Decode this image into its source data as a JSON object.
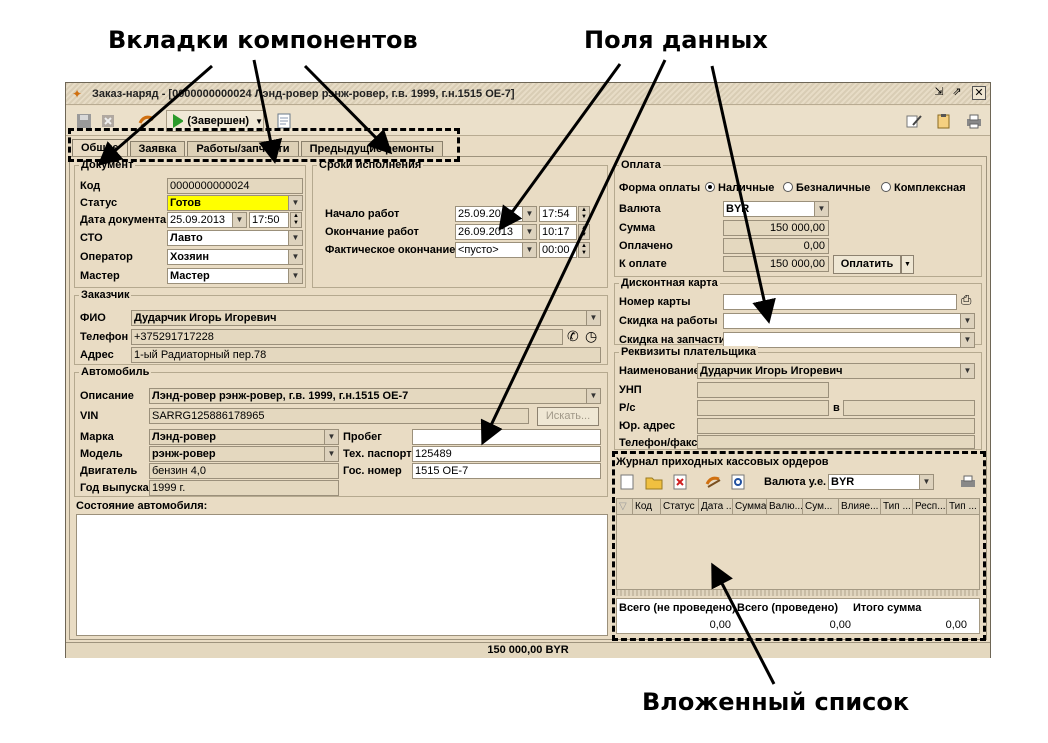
{
  "annotations": {
    "tabs_label": "Вкладки компонентов",
    "fields_label": "Поля данных",
    "nested_label": "Вложенный список"
  },
  "window": {
    "title": "Заказ-наряд - [0000000000024 Лэнд-ровер рэнж-ровер, г.в. 1999, г.н.1515 ОЕ-7]",
    "status_button": "(Завершен)"
  },
  "tabs": [
    "Общие",
    "Заявка",
    "Работы/запчасти",
    "Предыдущие ремонты"
  ],
  "document": {
    "title": "Документ",
    "code_label": "Код",
    "code": "0000000000024",
    "status_label": "Статус",
    "status": "Готов",
    "date_label": "Дата документа",
    "date": "25.09.2013",
    "time": "17:50",
    "sto_label": "СТО",
    "sto": "Лавто",
    "operator_label": "Оператор",
    "operator": "Хозяин",
    "master_label": "Мастер",
    "master": "Мастер"
  },
  "terms": {
    "title": "Сроки исполнения",
    "start_label": "Начало работ",
    "start_date": "25.09.2013",
    "start_time": "17:54",
    "end_label": "Окончание работ",
    "end_date": "26.09.2013",
    "end_time": "10:17",
    "actual_label": "Фактическое окончание",
    "actual_date": "<пусто>",
    "actual_time": "00:00"
  },
  "customer": {
    "title": "Заказчик",
    "fio_label": "ФИО",
    "fio": "Дударчик Игорь Игоревич",
    "phone_label": "Телефон",
    "phone": "+375291717228",
    "address_label": "Адрес",
    "address": "1-ый Радиаторный пер.78"
  },
  "car": {
    "title": "Автомобиль",
    "desc_label": "Описание",
    "desc": "Лэнд-ровер рэнж-ровер, г.в. 1999, г.н.1515 ОЕ-7",
    "vin_label": "VIN",
    "vin": "SARRG125886178965",
    "search_button": "Искать...",
    "make_label": "Марка",
    "make": "Лэнд-ровер",
    "model_label": "Модель",
    "model": "рэнж-ровер",
    "engine_label": "Двигатель",
    "engine": "бензин 4,0",
    "year_label": "Год выпуска",
    "year": "1999 г.",
    "mileage_label": "Пробег",
    "mileage": "",
    "passport_label": "Тех. паспорт",
    "passport": "125489",
    "plate_label": "Гос. номер",
    "plate": "1515 ОЕ-7",
    "condition_label": "Состояние автомобиля:"
  },
  "payment": {
    "title": "Оплата",
    "form_label": "Форма оплаты",
    "forms": [
      "Наличные",
      "Безналичные",
      "Комплексная"
    ],
    "currency_label": "Валюта",
    "currency": "BYR",
    "sum_label": "Сумма",
    "sum": "150 000,00",
    "paid_label": "Оплачено",
    "paid": "0,00",
    "topay_label": "К оплате",
    "topay": "150 000,00",
    "pay_button": "Оплатить"
  },
  "discount": {
    "title": "Дисконтная карта",
    "card_label": "Номер карты",
    "works_label": "Скидка на работы",
    "parts_label": "Скидка на запчасти"
  },
  "payer": {
    "title": "Реквизиты плательщика",
    "name_label": "Наименование",
    "name": "Дударчик Игорь Игоревич",
    "unp_label": "УНП",
    "rs_label": "Р/с",
    "bank_label": "в",
    "address_label": "Юр. адрес",
    "phone_label": "Телефон/факс"
  },
  "journal": {
    "title": "Журнал приходных кассовых ордеров",
    "currency_label": "Валюта у.е.",
    "currency": "BYR",
    "columns": [
      "Код",
      "Статус",
      "Дата ...",
      "Сумма",
      "Валю...",
      "Сум...",
      "Влияе...",
      "Тип ...",
      "Респ...",
      "Тип ..."
    ],
    "totals_headers": [
      "Всего (не проведено)",
      "Всего (проведено)",
      "Итого сумма"
    ],
    "totals_values": [
      "0,00",
      "0,00",
      "0,00"
    ]
  },
  "status_total": "150 000,00 BYR",
  "colors": {
    "window_bg": "#e9dcc4",
    "status_highlight": "#ffff00"
  }
}
